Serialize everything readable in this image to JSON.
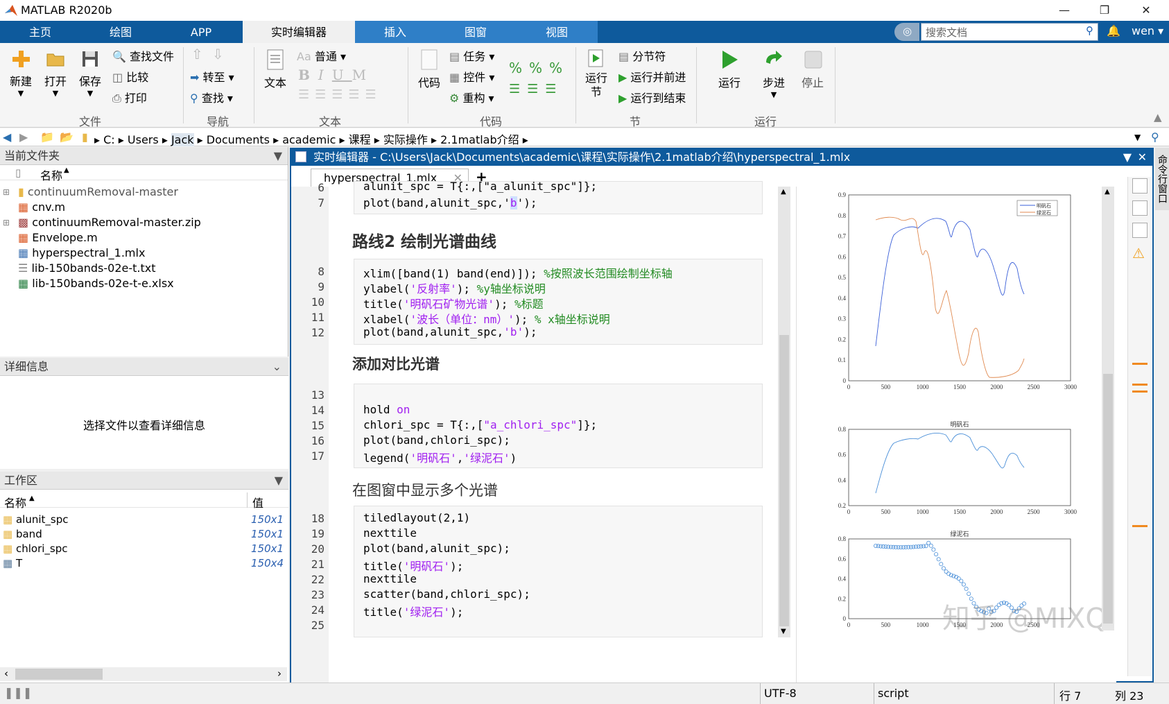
{
  "window": {
    "title": "MATLAB R2020b"
  },
  "tabs": [
    {
      "label": "主页"
    },
    {
      "label": "绘图"
    },
    {
      "label": "APP"
    },
    {
      "label": "实时编辑器"
    },
    {
      "label": "插入"
    },
    {
      "label": "图窗"
    },
    {
      "label": "视图"
    }
  ],
  "search": {
    "placeholder": "搜索文档"
  },
  "user": "wen",
  "ribbon": {
    "file": {
      "new": "新建",
      "open": "打开",
      "save": "保存",
      "find_files": "查找文件",
      "compare": "比较",
      "print": "打印",
      "group": "文件"
    },
    "nav": {
      "goto": "转至",
      "find": "查找",
      "group": "导航"
    },
    "text": {
      "text": "文本",
      "style": "普通",
      "group": "文本"
    },
    "code": {
      "code": "代码",
      "task": "任务",
      "control": "控件",
      "refactor": "重构",
      "group": "代码"
    },
    "section": {
      "run_section": "运行\n节",
      "section_break": "分节符",
      "run_advance": "运行并前进",
      "run_to_end": "运行到结束",
      "group": "节"
    },
    "run": {
      "run": "运行",
      "step": "步进",
      "stop": "停止",
      "group": "运行"
    }
  },
  "address": [
    "C:",
    "Users",
    "Jack",
    "Documents",
    "academic",
    "课程",
    "实际操作",
    "2.1matlab介绍"
  ],
  "filebrowser": {
    "title": "当前文件夹",
    "col_name": "名称",
    "items": [
      "continuumRemoval-master",
      "cnv.m",
      "continuumRemoval-master.zip",
      "Envelope.m",
      "hyperspectral_1.mlx",
      "lib-150bands-02e-t.txt",
      "lib-150bands-02e-t-e.xlsx"
    ]
  },
  "details": {
    "title": "详细信息",
    "message": "选择文件以查看详细信息"
  },
  "workspace": {
    "title": "工作区",
    "col_name": "名称",
    "col_value": "值",
    "rows": [
      {
        "name": "alunit_spc",
        "value": "150x1"
      },
      {
        "name": "band",
        "value": "150x1"
      },
      {
        "name": "chlori_spc",
        "value": "150x1"
      },
      {
        "name": "T",
        "value": "150x4"
      }
    ]
  },
  "editor": {
    "title": "实时编辑器 - C:\\Users\\Jack\\Documents\\academic\\课程\\实际操作\\2.1matlab介绍\\hyperspectral_1.mlx",
    "tab": "hyperspectral_1.mlx",
    "heading1": "路线2 绘制光谱曲线",
    "heading2": "添加对比光谱",
    "heading3": "在图窗中显示多个光谱",
    "lines": {
      "l6": "alunit_spc = T{:,[\"a_alunit_spc\"]};",
      "l7a": "plot(band,alunit_spc,'",
      "l7b": "b",
      "l7c": "');",
      "l8a": "xlim([band(1) band(end)]); ",
      "l8c": "%按照波长范围绘制坐标轴",
      "l9a": "ylabel(",
      "l9s": "'反射率'",
      "l9b": "); ",
      "l9c": "%y轴坐标说明",
      "l10a": "title(",
      "l10s": "'明矾石矿物光谱'",
      "l10b": "); ",
      "l10c": "%标题",
      "l11a": "xlabel(",
      "l11s": "'波长（单位：nm）'",
      "l11b": "); ",
      "l11c": "% x轴坐标说明",
      "l12a": "plot(band,alunit_spc,",
      "l12s": "'b'",
      "l12b": ");",
      "l14a": "hold ",
      "l14k": "on",
      "l15a": "chlori_spc = T{:,[",
      "l15s": "\"a_chlori_spc\"",
      "l15b": "]};",
      "l16": "plot(band,chlori_spc);",
      "l17a": "legend(",
      "l17s1": "'明矾石'",
      "l17m": ",",
      "l17s2": "'绿泥石'",
      "l17b": ")",
      "l18": "tiledlayout(2,1)",
      "l19": "nexttile",
      "l20": "plot(band,alunit_spc);",
      "l21a": "title(",
      "l21s": "'明矾石'",
      "l21b": ");",
      "l22": "nexttile",
      "l23": "scatter(band,chlori_spc);",
      "l24a": "title(",
      "l24s": "'绿泥石'",
      "l24b": ");"
    }
  },
  "figures": {
    "legend1": "明矾石",
    "legend2": "绿泥石",
    "title2": "明矾石",
    "title3": "绿泥石",
    "xticks": [
      "0",
      "500",
      "1000",
      "1500",
      "2000",
      "2500",
      "3000"
    ],
    "yticks1": [
      "0",
      "0.1",
      "0.2",
      "0.3",
      "0.4",
      "0.5",
      "0.6",
      "0.7",
      "0.8",
      "0.9"
    ],
    "yticks2": [
      "0.2",
      "0.4",
      "0.6",
      "0.8"
    ],
    "yticks3": [
      "0",
      "0.2",
      "0.4",
      "0.6",
      "0.8"
    ],
    "watermark": "知乎 @MIXQ"
  },
  "side_panel": "命令行窗口",
  "status": {
    "encoding": "UTF-8",
    "type": "script",
    "row_label": "行",
    "row": "7",
    "col_label": "列",
    "col": "23"
  },
  "colors": {
    "accent": "#0e5a9c",
    "series1": "#3a5fd8",
    "series2": "#e08a50"
  }
}
